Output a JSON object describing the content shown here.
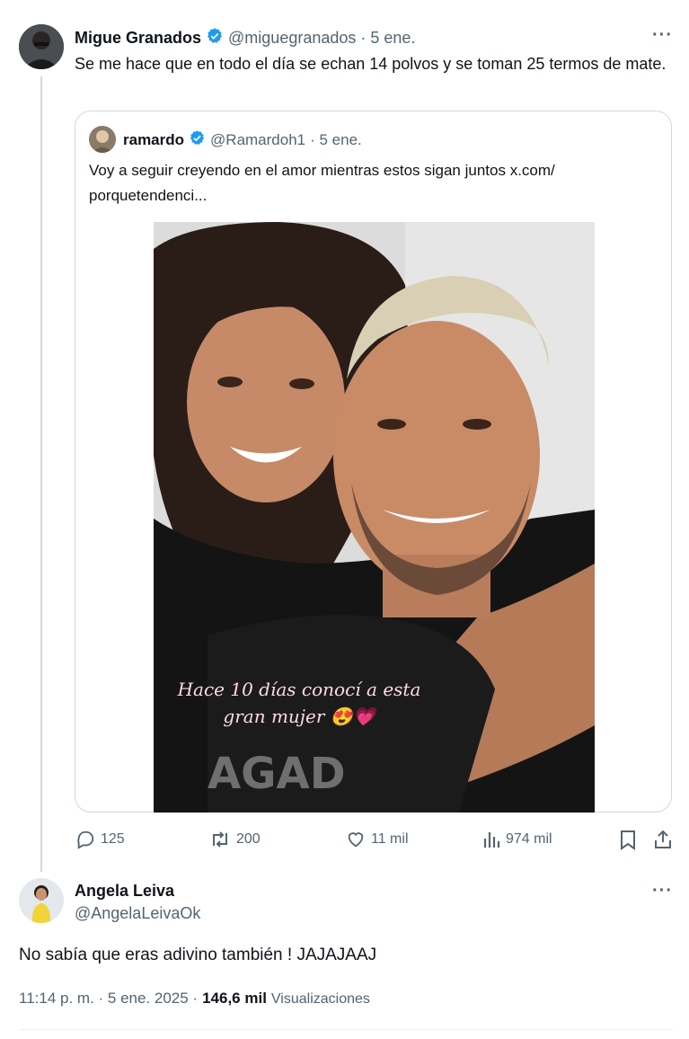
{
  "original_tweet": {
    "author_name": "Migue Granados",
    "handle": "@miguegranados",
    "date": "· 5 ene.",
    "text": "Se me hace que en todo el día se echan 14 polvos y se toman 25 termos de mate.",
    "more": "···"
  },
  "quoted_tweet": {
    "author_name": "ramardo",
    "handle": "@Ramardoh1",
    "date": "· 5 ene.",
    "text_line1": "Voy a seguir creyendo en el amor mientras estos sigan juntos  x.com/",
    "text_line2": "porquetendenci...",
    "photo_caption_line1": "Hace 10 días conocí a esta",
    "photo_caption_line2": "gran mujer 😍💗"
  },
  "actions": {
    "replies": "125",
    "reposts": "200",
    "likes": "11 mil",
    "views": "974 mil"
  },
  "reply_tweet": {
    "author_name": "Angela Leiva",
    "handle": "@AngelaLeivaOk",
    "text": "No sabía que eras adivino también ! JAJAJAAJ",
    "time": "11:14 p. m. · 5 ene. 2025 ·",
    "views_count": "146,6 mil",
    "views_label": "Visualizaciones",
    "more": "···"
  },
  "colors": {
    "verified": "#1d9bf0",
    "muted": "#536471",
    "border": "#cfd9de"
  }
}
